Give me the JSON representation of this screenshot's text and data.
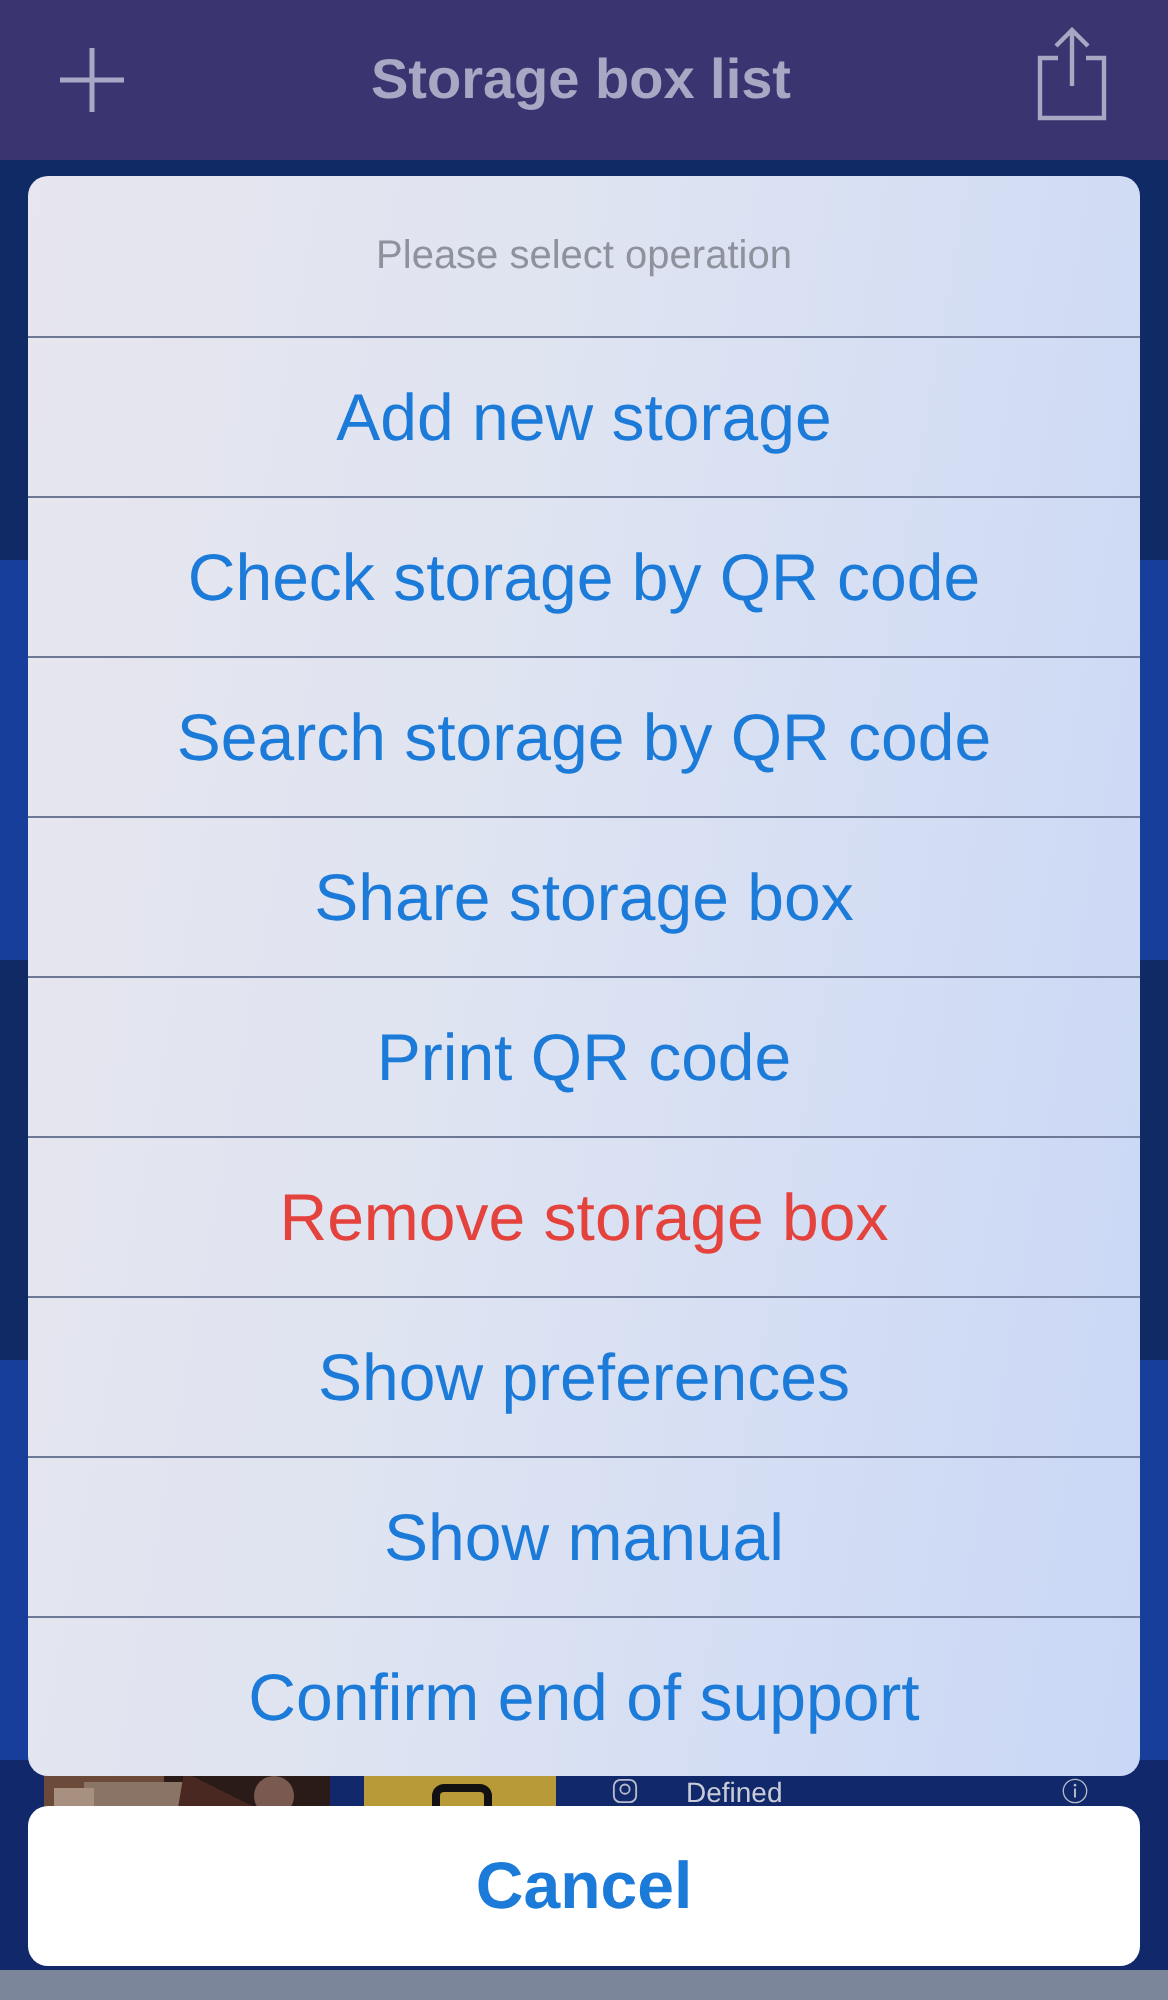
{
  "nav_bar": {
    "title": "Storage box list"
  },
  "background_row": {
    "status": "Defined"
  },
  "action_sheet": {
    "title": "Please select operation",
    "actions": [
      {
        "label": "Add new storage",
        "kind": "default"
      },
      {
        "label": "Check storage by QR code",
        "kind": "default"
      },
      {
        "label": "Search storage by QR code",
        "kind": "default"
      },
      {
        "label": "Share storage box",
        "kind": "default"
      },
      {
        "label": "Print QR code",
        "kind": "default"
      },
      {
        "label": "Remove storage box",
        "kind": "destructive"
      },
      {
        "label": "Show preferences",
        "kind": "default"
      },
      {
        "label": "Show manual",
        "kind": "default"
      },
      {
        "label": "Confirm end of support",
        "kind": "default"
      }
    ],
    "cancel": "Cancel"
  }
}
